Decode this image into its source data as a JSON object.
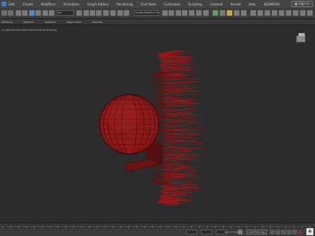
{
  "menubar": {
    "items": [
      "Edit",
      "Create",
      "Modifiers",
      "Animation",
      "Graph Editors",
      "Rendering",
      "Civil View",
      "Customize",
      "Scripting",
      "Content",
      "Arnold",
      "Help",
      "3DSMOD6"
    ],
    "signin_label": "Sign In"
  },
  "toolbar": {
    "selection_filter": "All",
    "named_selection": "Create Selection Set"
  },
  "ribbon": {
    "tabs": [
      "Modeling",
      "Freeform",
      "Selection",
      "Object Paint",
      "Populate"
    ]
  },
  "viewport": {
    "label": "[+] [Perspective] [Standard] [Default Shading]"
  },
  "status": {
    "selection_text": "",
    "prompt_text": "",
    "grid_text": "Grid = 10.0mm",
    "add_time_tag": "Add Time Tag",
    "set_key": "Set Key",
    "auto_key": "Auto Key",
    "plus_label": "+"
  },
  "colors": {
    "model": "#8e1a1a",
    "model_grid": "#3a0505",
    "hair": "#a01818",
    "background": "#2c2c2c"
  }
}
